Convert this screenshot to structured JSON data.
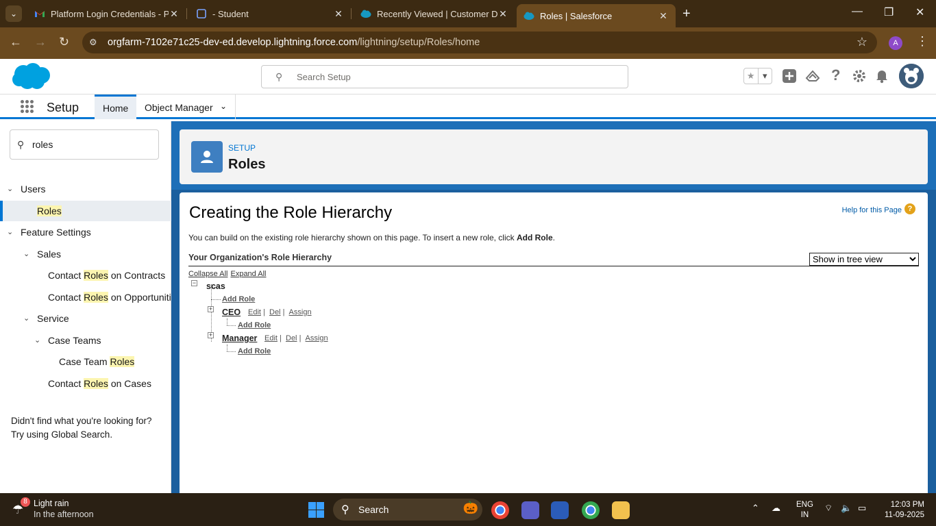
{
  "browser": {
    "tabs": [
      {
        "title": "Platform Login Credentials - Pro",
        "icon": "gmail-icon"
      },
      {
        "title": "- Student",
        "icon": "tab-page-icon"
      },
      {
        "title": "Recently Viewed | Customer Det",
        "icon": "salesforce-cloud-icon"
      },
      {
        "title": "Roles | Salesforce",
        "icon": "salesforce-cloud-icon",
        "active": true
      }
    ],
    "url_host": "orgfarm-7102e71c25-dev-ed.develop.lightning.force.com",
    "url_path": "/lightning/setup/Roles/home",
    "profile_initial": "A"
  },
  "header": {
    "search_placeholder": "Search Setup"
  },
  "nav": {
    "app_name": "Setup",
    "tabs": [
      {
        "label": "Home"
      },
      {
        "label": "Object Manager"
      }
    ]
  },
  "sidebar": {
    "quick_find_value": "roles",
    "items": [
      {
        "pre": "Users",
        "hl": "",
        "post": ""
      },
      {
        "pre": "",
        "hl": "Roles",
        "post": ""
      },
      {
        "pre": "Feature Settings",
        "hl": "",
        "post": ""
      },
      {
        "pre": "Sales",
        "hl": "",
        "post": ""
      },
      {
        "pre": "Contact ",
        "hl": "Roles",
        "post": " on Contracts"
      },
      {
        "pre": "Contact ",
        "hl": "Roles",
        "post": " on Opportunities"
      },
      {
        "pre": "Service",
        "hl": "",
        "post": ""
      },
      {
        "pre": "Case Teams",
        "hl": "",
        "post": ""
      },
      {
        "pre": "Case Team ",
        "hl": "Roles",
        "post": ""
      },
      {
        "pre": "Contact ",
        "hl": "Roles",
        "post": " on Cases"
      }
    ],
    "not_found_line1": "Didn't find what you're looking for?",
    "not_found_line2": "Try using Global Search."
  },
  "page": {
    "breadcrumb": "SETUP",
    "title": "Roles",
    "heading": "Creating the Role Hierarchy",
    "help_link": "Help for this Page",
    "intro_text": "You can build on the existing role hierarchy shown on this page. To insert a new role, click ",
    "intro_bold": "Add Role",
    "intro_end": ".",
    "hierarchy_heading": "Your Organization's Role Hierarchy",
    "view_select": "Show in tree view",
    "collapse_all": "Collapse All",
    "expand_all": "Expand All",
    "root": "scas",
    "add_role": "Add Role",
    "roles": [
      {
        "name": "CEO",
        "edit": "Edit",
        "del": "Del",
        "assign": "Assign"
      },
      {
        "name": "Manager",
        "edit": "Edit",
        "del": "Del",
        "assign": "Assign"
      }
    ]
  },
  "taskbar": {
    "weather_badge": "8",
    "weather_title": "Light rain",
    "weather_sub": "In the afternoon",
    "search_label": "Search",
    "lang_1": "ENG",
    "lang_2": "IN",
    "time": "12:03 PM",
    "date": "11-09-2025"
  }
}
